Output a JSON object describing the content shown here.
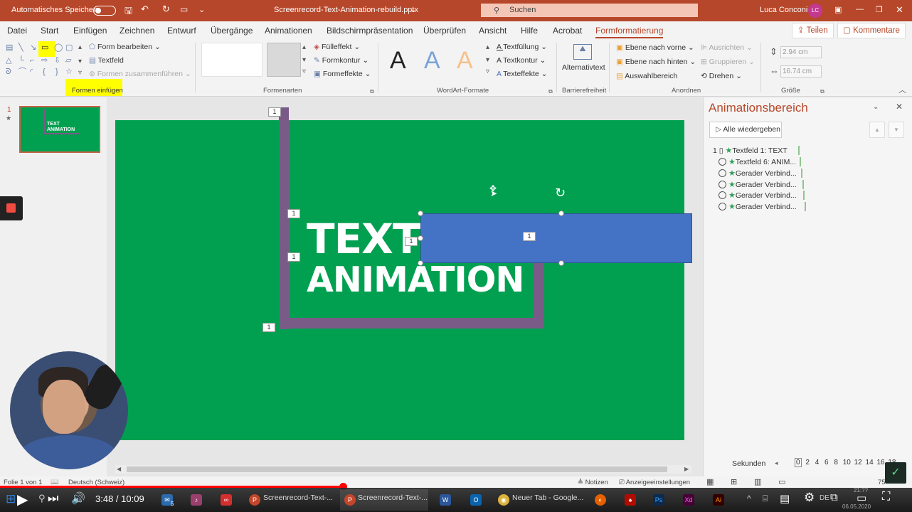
{
  "titlebar": {
    "autosave": "Automatisches Speichern",
    "filename": "Screenrecord-Text-Animation-rebuild.pptx",
    "search": "Suchen",
    "user": "Luca Conconi",
    "initials": "LC"
  },
  "tabs": [
    "Datei",
    "Start",
    "Einfügen",
    "Zeichnen",
    "Entwurf",
    "Übergänge",
    "Animationen",
    "Bildschirmpräsentation",
    "Überprüfen",
    "Ansicht",
    "Hilfe",
    "Acrobat",
    "Formformatierung"
  ],
  "share": "Teilen",
  "comments": "Kommentare",
  "ribbon": {
    "form_bearbeiten": "Form bearbeiten",
    "textfeld": "Textfeld",
    "formen_zusammen": "Formen zusammenführen",
    "formen_einfuegen": "Formen einfügen",
    "fuelleffekt": "Fülleffekt",
    "formkontur": "Formkontur",
    "formeffekte": "Formeffekte",
    "formenarten": "Formenarten",
    "textfuellung": "Textfüllung",
    "textkontur": "Textkontur",
    "texteffekte": "Texteffekte",
    "wordart": "WordArt-Formate",
    "alternativtext": "Alternativtext",
    "barrierefreiheit": "Barrierefreiheit",
    "ebene_vorne": "Ebene nach vorne",
    "ebene_hinten": "Ebene nach hinten",
    "auswahlbereich": "Auswahlbereich",
    "ausrichten": "Ausrichten",
    "gruppieren": "Gruppieren",
    "drehen": "Drehen",
    "anordnen": "Anordnen",
    "height": "2.94 cm",
    "width": "16.74 cm",
    "groesse": "Größe"
  },
  "slide": {
    "number": "1",
    "thumb_text1": "TEXT",
    "thumb_text2": "ANIMATION",
    "text1": "TEXT",
    "text2": "ANIMATION",
    "tag": "1"
  },
  "anim": {
    "title": "Animationsbereich",
    "play_all": "Alle wiedergeben",
    "row_index": "1",
    "items": [
      "Textfeld 1: TEXT",
      "Textfeld 6: ANIM...",
      "Gerader Verbind...",
      "Gerader Verbind...",
      "Gerader Verbind...",
      "Gerader Verbind..."
    ],
    "seconds_label": "Sekunden",
    "seconds": [
      "0",
      "2",
      "4",
      "6",
      "8",
      "10",
      "12",
      "14",
      "16",
      "18"
    ]
  },
  "status": {
    "slide": "Folie 1 von 1",
    "language": "Deutsch (Schweiz)",
    "notes": "Notizen",
    "display": "Anzeigeeinstellungen",
    "zoom": "75"
  },
  "player": {
    "time": "3:48 / 10:09",
    "progress": 0.375
  },
  "taskbar": {
    "ppt1": "Screenrecord-Text-...",
    "ppt2": "Screenrecord-Text-...",
    "chrome": "Neuer Tab - Google...",
    "lang": "DE",
    "clock": "21:??",
    "date": "06.05.2020",
    "mail_badge": "5"
  },
  "colors": {
    "ppt": "#b7472a",
    "slide": "#00a050",
    "frame": "#7a5a86",
    "box": "#4472c4",
    "highlight": "#ffff00"
  }
}
